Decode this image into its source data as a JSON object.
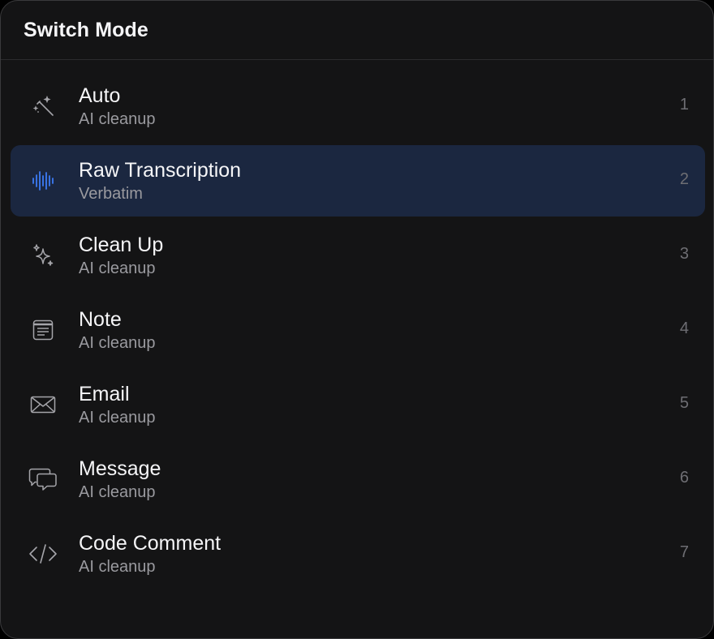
{
  "header": {
    "title": "Switch Mode"
  },
  "colors": {
    "background": "#141415",
    "selected_row": "#1b2740",
    "accent": "#3b7bf5",
    "icon": "#a5a5aa"
  },
  "modes": [
    {
      "title": "Auto",
      "subtitle": "AI cleanup",
      "shortcut": "1",
      "icon": "magic-wand-icon"
    },
    {
      "title": "Raw Transcription",
      "subtitle": "Verbatim",
      "shortcut": "2",
      "icon": "waveform-icon",
      "selected": true
    },
    {
      "title": "Clean Up",
      "subtitle": "AI cleanup",
      "shortcut": "3",
      "icon": "sparkles-icon"
    },
    {
      "title": "Note",
      "subtitle": "AI cleanup",
      "shortcut": "4",
      "icon": "note-icon"
    },
    {
      "title": "Email",
      "subtitle": "AI cleanup",
      "shortcut": "5",
      "icon": "envelope-icon"
    },
    {
      "title": "Message",
      "subtitle": "AI cleanup",
      "shortcut": "6",
      "icon": "chat-bubbles-icon"
    },
    {
      "title": "Code Comment",
      "subtitle": "AI cleanup",
      "shortcut": "7",
      "icon": "code-brackets-icon"
    }
  ]
}
